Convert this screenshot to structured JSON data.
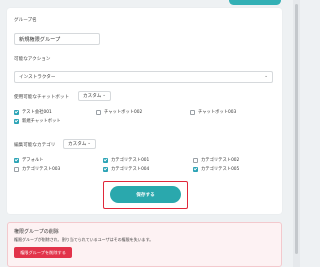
{
  "form": {
    "group_name_label": "グループ名",
    "group_name_value": "新規権限グループ",
    "action_label": "可能なアクション",
    "action_value": "インストラクター",
    "chatbots": {
      "label": "使用可能なチャットボット",
      "mode": "カスタム",
      "items": [
        {
          "label": "テスト会社001",
          "checked": true
        },
        {
          "label": "チャットボット002",
          "checked": false
        },
        {
          "label": "チャットボット003",
          "checked": false
        },
        {
          "label": "新規チャットボット",
          "checked": true
        }
      ]
    },
    "categories": {
      "label": "編集可能なカテゴリ",
      "mode": "カスタム",
      "items": [
        {
          "label": "デフォルト",
          "checked": true
        },
        {
          "label": "カテゴリテスト001",
          "checked": true
        },
        {
          "label": "カテゴリテスト002",
          "checked": false
        },
        {
          "label": "カテゴリテスト003",
          "checked": false
        },
        {
          "label": "カテゴリテスト004",
          "checked": true
        },
        {
          "label": "カテゴリテスト005",
          "checked": true
        }
      ]
    },
    "save_label": "保存する"
  },
  "danger_zone": {
    "title": "権限グループの削除",
    "description": "権限グループが削除され、割り当てられているユーザはその権限を失います。",
    "delete_label": "権限グループを削除する"
  },
  "colors": {
    "accent": "#2aa8ad",
    "danger": "#e2334a",
    "highlight_frame": "#e0283a"
  }
}
